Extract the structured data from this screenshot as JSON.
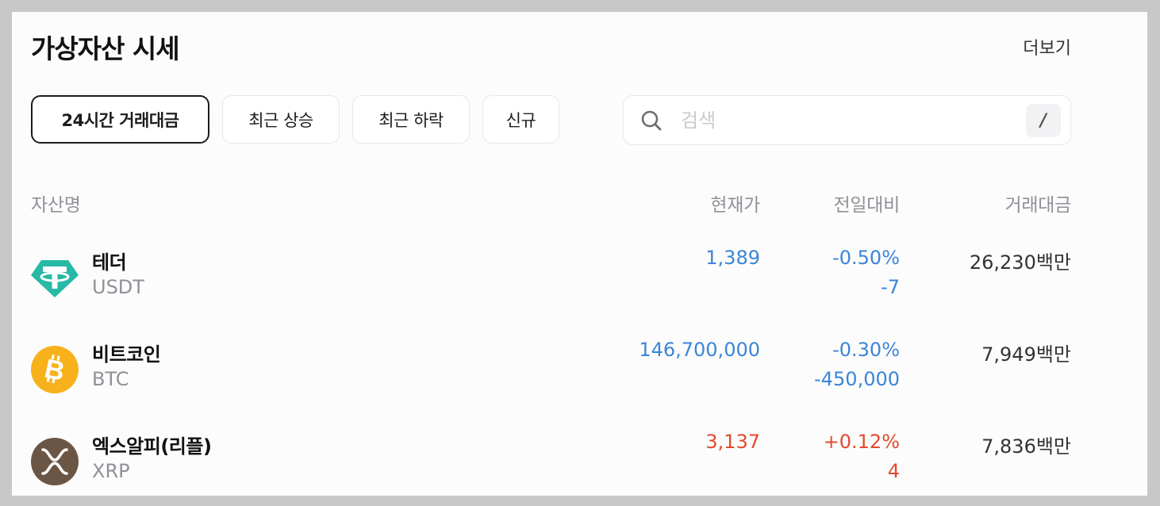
{
  "header": {
    "title": "가상자산 시세",
    "more_label": "더보기"
  },
  "tabs": [
    {
      "label": "24시간 거래대금",
      "active": true
    },
    {
      "label": "최근 상승",
      "active": false
    },
    {
      "label": "최근 하락",
      "active": false
    },
    {
      "label": "신규",
      "active": false
    }
  ],
  "search": {
    "placeholder": "검색",
    "value": "",
    "shortcut": "/",
    "icon": "search-icon"
  },
  "table": {
    "columns": {
      "asset": "자산명",
      "price": "현재가",
      "change": "전일대비",
      "volume": "거래대금"
    },
    "rows": [
      {
        "name": "테더",
        "symbol": "USDT",
        "icon": "tether-icon",
        "price": "1,389",
        "change_rate": "-0.50%",
        "change_amount": "-7",
        "volume": "26,230백만",
        "direction": "down"
      },
      {
        "name": "비트코인",
        "symbol": "BTC",
        "icon": "bitcoin-icon",
        "price": "146,700,000",
        "change_rate": "-0.30%",
        "change_amount": "-450,000",
        "volume": "7,949백만",
        "direction": "down"
      },
      {
        "name": "엑스알피(리플)",
        "symbol": "XRP",
        "icon": "xrp-icon",
        "price": "3,137",
        "change_rate": "+0.12%",
        "change_amount": "4",
        "volume": "7,836백만",
        "direction": "up"
      }
    ]
  },
  "colors": {
    "down": "#3a85d8",
    "up": "#e4492f",
    "tether": "#26b9a5",
    "bitcoin": "#f7b21b",
    "xrp": "#6b5646"
  }
}
